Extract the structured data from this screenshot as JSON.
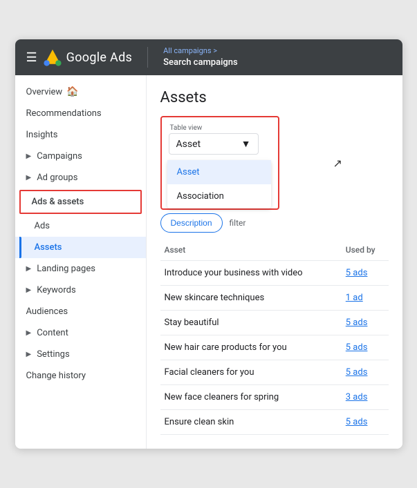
{
  "topbar": {
    "hamburger_label": "☰",
    "brand_name": "Google Ads",
    "breadcrumb_parent": "All campaigns >",
    "breadcrumb_current": "Search campaigns"
  },
  "sidebar": {
    "items": [
      {
        "id": "overview",
        "label": "Overview",
        "has_home": true,
        "indent": false
      },
      {
        "id": "recommendations",
        "label": "Recommendations",
        "indent": false
      },
      {
        "id": "insights",
        "label": "Insights",
        "indent": false
      },
      {
        "id": "campaigns",
        "label": "Campaigns",
        "has_chevron": true,
        "indent": false
      },
      {
        "id": "ad-groups",
        "label": "Ad groups",
        "has_chevron": true,
        "indent": false
      }
    ],
    "section_header": "Ads & assets",
    "section_items": [
      {
        "id": "ads",
        "label": "Ads"
      },
      {
        "id": "assets",
        "label": "Assets",
        "active": true
      }
    ],
    "bottom_items": [
      {
        "id": "landing-pages",
        "label": "Landing pages",
        "has_chevron": true
      },
      {
        "id": "keywords",
        "label": "Keywords",
        "has_chevron": true
      },
      {
        "id": "audiences",
        "label": "Audiences"
      },
      {
        "id": "content",
        "label": "Content",
        "has_chevron": true
      },
      {
        "id": "settings",
        "label": "Settings",
        "has_chevron": true
      },
      {
        "id": "change-history",
        "label": "Change history"
      }
    ]
  },
  "content": {
    "page_title": "Assets",
    "table_view_label": "Table view",
    "dropdown_value": "Asset",
    "dropdown_options": [
      {
        "label": "Asset",
        "selected": true
      },
      {
        "label": "Association",
        "selected": false
      }
    ],
    "tabs": [
      {
        "label": "Description",
        "active": true
      }
    ],
    "filter_label": "filter",
    "table": {
      "headers": [
        {
          "label": "Asset"
        },
        {
          "label": "Used by"
        }
      ],
      "rows": [
        {
          "asset": "Introduce your business with video",
          "used_by": "5 ads"
        },
        {
          "asset": "New skincare techniques",
          "used_by": "1 ad"
        },
        {
          "asset": "Stay beautiful",
          "used_by": "5 ads"
        },
        {
          "asset": "New hair care products for you",
          "used_by": "5 ads"
        },
        {
          "asset": "Facial cleaners for you",
          "used_by": "5 ads"
        },
        {
          "asset": "New face cleaners for spring",
          "used_by": "3 ads"
        },
        {
          "asset": "Ensure clean skin",
          "used_by": "5 ads"
        }
      ]
    }
  }
}
